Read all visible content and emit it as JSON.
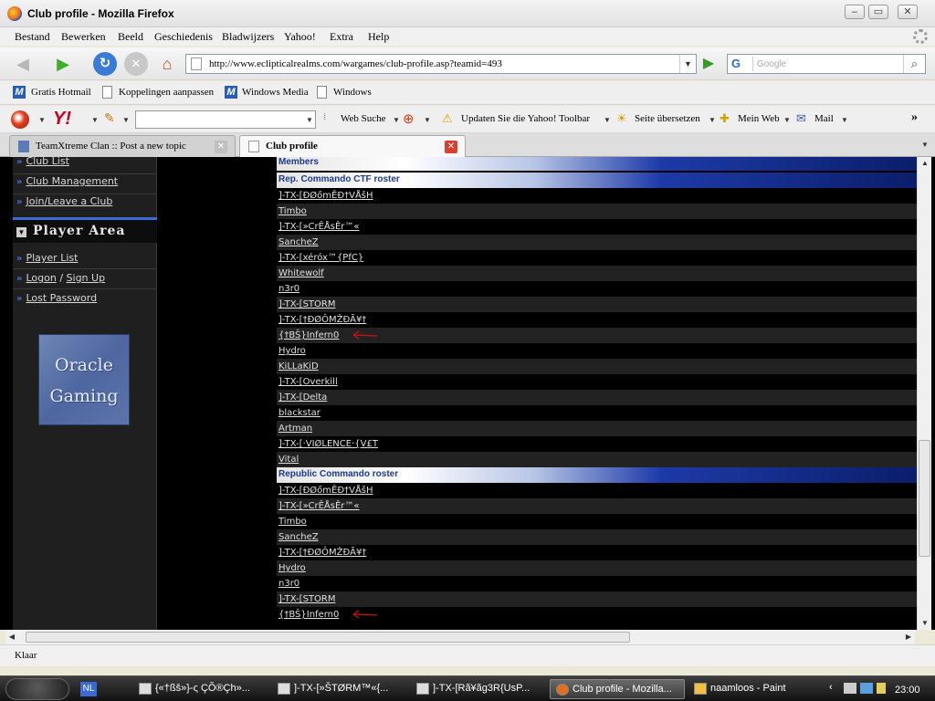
{
  "window": {
    "title": "Club profile - Mozilla Firefox"
  },
  "menu": [
    "Bestand",
    "Bewerken",
    "Beeld",
    "Geschiedenis",
    "Bladwijzers",
    "Yahoo!",
    "Extra",
    "Help"
  ],
  "navigation": {
    "url": "http://www.eclipticalrealms.com/wargames/club-profile.asp?teamid=493",
    "search_engine": "G",
    "search_placeholder": "Google"
  },
  "bookmarks": [
    "Gratis Hotmail",
    "Koppelingen aanpassen",
    "Windows Media",
    "Windows"
  ],
  "yahoo_toolbar": {
    "logo": "Y!",
    "web_search": "Web Suche",
    "update": "Updaten Sie die Yahoo! Toolbar",
    "translate": "Seite übersetzen",
    "my_web": "Mein Web",
    "mail": "Mail",
    "more": "»"
  },
  "tabs": [
    {
      "label": "TeamXtreme Clan :: Post a new topic",
      "active": false
    },
    {
      "label": "Club profile",
      "active": true
    }
  ],
  "sidebar": {
    "links_top": [
      "Club List",
      "Club Management",
      "Join/Leave a Club"
    ],
    "section_title": "Player Area",
    "player_list": "Player List",
    "logon": "Logon",
    "signup": "Sign Up",
    "lost_password": "Lost Password",
    "banner_line1": "Oracle",
    "banner_line2": "Gaming"
  },
  "roster": {
    "members_header": "Members",
    "ctf_header": "Rep. Commando CTF roster",
    "ctf_members": [
      "]-TX-[ÐØőmÊÐ†VÅšH",
      "Timbo",
      "]-TX-[»CrÊÅsÊr™«",
      "SancheZ",
      "]-TX-[xéróx™{PfC}",
      "Whitewolf",
      "n3r0",
      "]-TX-[STORM",
      "]-TX-[†ÐØÔMŽÐÃ¥†",
      "{†BŠ}Infern0",
      "Hydro",
      "KiLLaKiD",
      "]-TX-[Overkill",
      "]-TX-[Delta",
      "blackstar",
      "Artman",
      "]-TX-[·VIØLENCE·{V£T",
      "Vital"
    ],
    "rc_header": "Republic Commando roster",
    "rc_members": [
      "]-TX-[ÐØőmÊÐ†VÅšH",
      "]-TX-[»CrÊÅsÊr™«",
      "Timbo",
      "SancheZ",
      "]-TX-[†ÐØÔMŽÐÃ¥†",
      "Hydro",
      "n3r0",
      "]-TX-[STORM",
      "{†BŠ}Infern0"
    ]
  },
  "status": "Klaar",
  "taskbar": {
    "language": "NL",
    "tasks": [
      {
        "label": "{«†ßš»}-ς ÇÕ®Çh»...",
        "active": false
      },
      {
        "label": "]-TX-[»ŠTØRM™«{...",
        "active": false
      },
      {
        "label": "]-TX-[Rã¥ãg3R{UsP...",
        "active": false
      },
      {
        "label": "Club profile - Mozilla...",
        "active": true
      },
      {
        "label": "naamloos - Paint",
        "active": false
      }
    ],
    "time": "23:00"
  },
  "colors": {
    "roster_header_text": "#1b3a8c",
    "sidebar_accent": "#3c6ad8",
    "tab_close": "#d9412e",
    "annotation_arrow": "#d01010"
  }
}
